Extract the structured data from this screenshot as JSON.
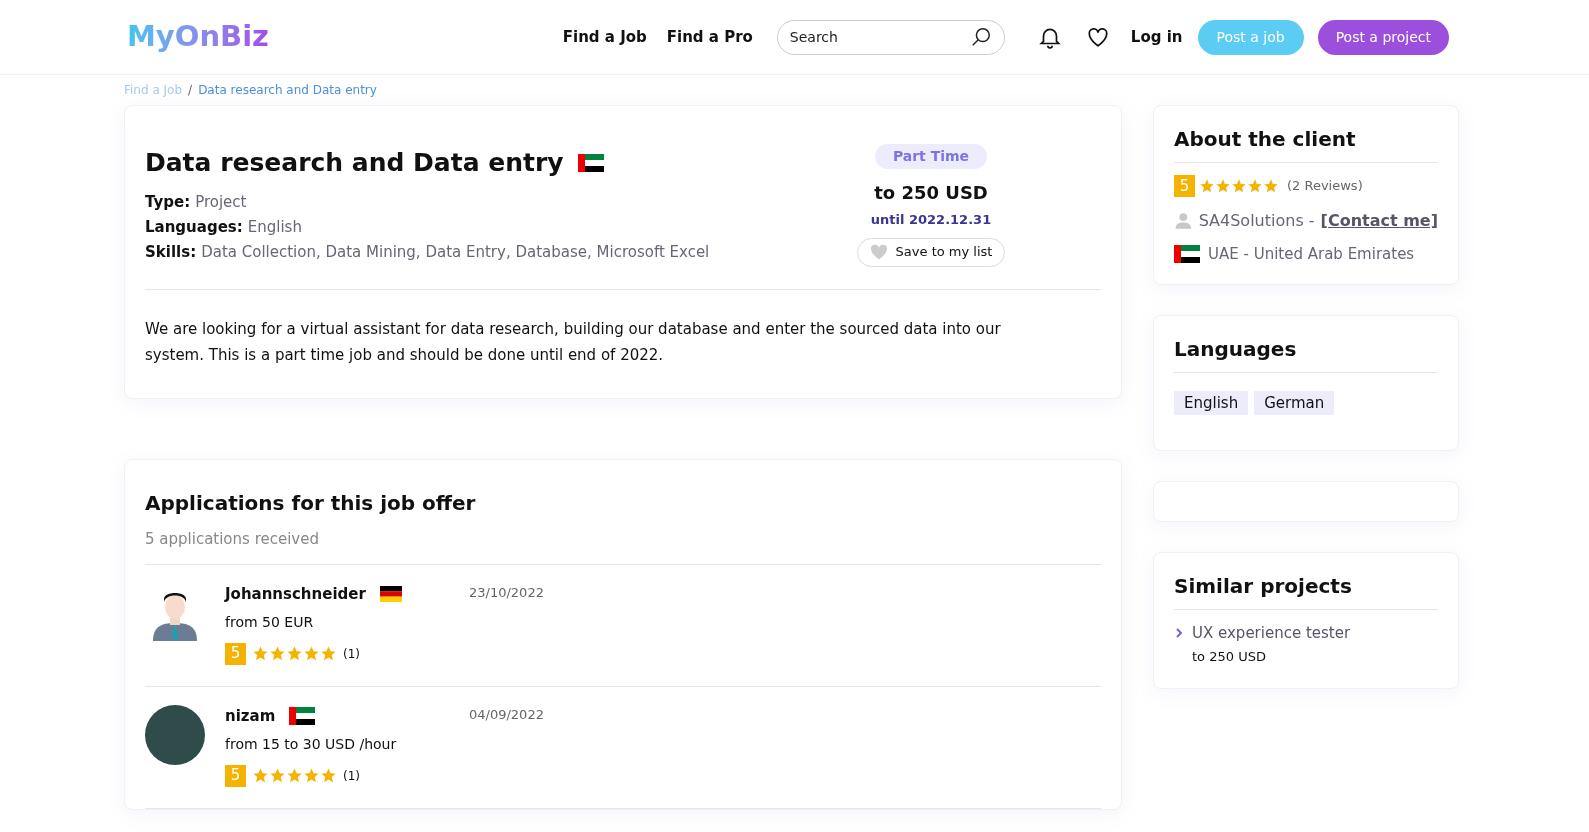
{
  "header": {
    "logo": "MyOnBiz",
    "nav": [
      "Find a Job",
      "Find a Pro"
    ],
    "search": {
      "placeholder": "Search"
    },
    "login": "Log in",
    "post_job": "Post a job",
    "post_project": "Post a project"
  },
  "breadcrumb_separator": "/",
  "breadcrumb": [
    {
      "label": "Find a Job",
      "selected": false
    },
    {
      "label": "Data research and Data entry",
      "selected": true
    }
  ],
  "job": {
    "title": "Data research and Data entry",
    "details": [
      {
        "label": "Type:",
        "value": "Project"
      },
      {
        "label": "Languages:",
        "value": "English"
      },
      {
        "label": "Skills:",
        "value": "Data Collection, Data Mining, Data Entry, Database, Microsoft Excel"
      }
    ],
    "badge": "Part Time",
    "budget": "to 250 USD",
    "deadline": "until 2022.12.31",
    "save": "Save to my list",
    "description": "We are looking for a virtual assistant for data research, building our database and enter the sourced data into our system. This is a part time job and should be done until end of 2022."
  },
  "applications": {
    "title": "Applications for this job offer",
    "count": "5 applications received",
    "items": [
      {
        "name": "Johannschneider",
        "kind": "cartoon",
        "rate": "from 50 EUR",
        "score": "5",
        "stars": 5,
        "reviews": "(1)",
        "date": "23/10/2022"
      },
      {
        "name": "nizam",
        "kind": "photo",
        "rate": "from 15 to 30 USD /hour",
        "score": "5",
        "stars": 5,
        "reviews": "(1)",
        "date": "04/09/2022"
      }
    ]
  },
  "client": {
    "title": "About the client",
    "score": "5",
    "stars": 5,
    "reviews": "(2 Reviews)",
    "name": "SA4Solutions -",
    "contact": "[Contact me]",
    "country": "UAE - United Arab Emirates"
  },
  "languages": {
    "title": "Languages",
    "items": [
      "English",
      "German"
    ]
  },
  "similar": {
    "title": "Similar projects",
    "items": [
      {
        "name": "UX experience tester",
        "budget": "to 250 USD"
      }
    ]
  }
}
